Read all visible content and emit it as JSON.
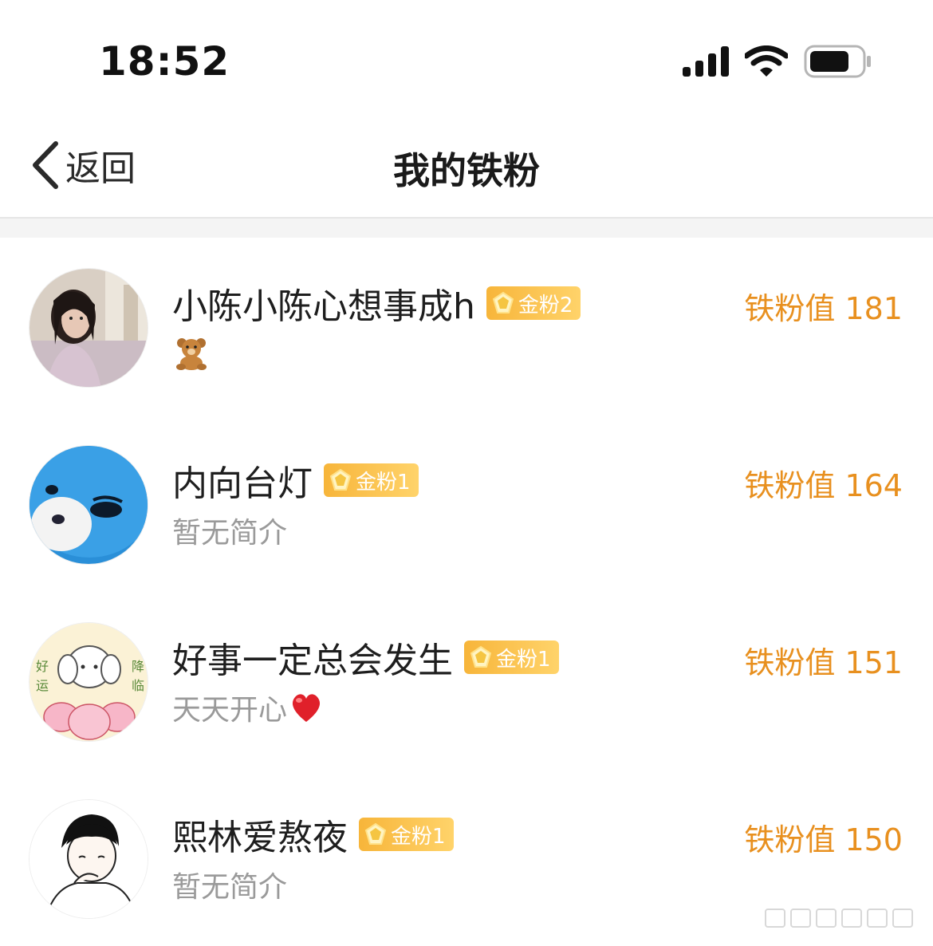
{
  "status_bar": {
    "time": "18:52",
    "icons": [
      "signal-icon",
      "wifi-icon",
      "battery-icon"
    ]
  },
  "nav": {
    "back_label": "返回",
    "title": "我的铁粉"
  },
  "colors": {
    "score": "#e8901f",
    "badge": "#f7b53a",
    "bio": "#9a9a9a"
  },
  "fans": [
    {
      "name": "小陈小陈心想事成h",
      "badge": "金粉2",
      "bio": "",
      "bio_emoji": "bear-emoji-icon",
      "score": "铁粉值 181"
    },
    {
      "name": "内向台灯",
      "badge": "金粉1",
      "bio": "暂无简介",
      "score": "铁粉值 164"
    },
    {
      "name": "好事一定总会发生",
      "badge": "金粉1",
      "bio": "天天开心",
      "bio_emoji": "red-heart-icon",
      "score": "铁粉值 151"
    },
    {
      "name": "熙林爱熬夜",
      "badge": "金粉1",
      "bio": "暂无简介",
      "score": "铁粉值 150"
    }
  ],
  "avatar_text": {
    "left_top": "好",
    "left_bottom": "运",
    "right_top": "降",
    "right_bottom": "临"
  }
}
